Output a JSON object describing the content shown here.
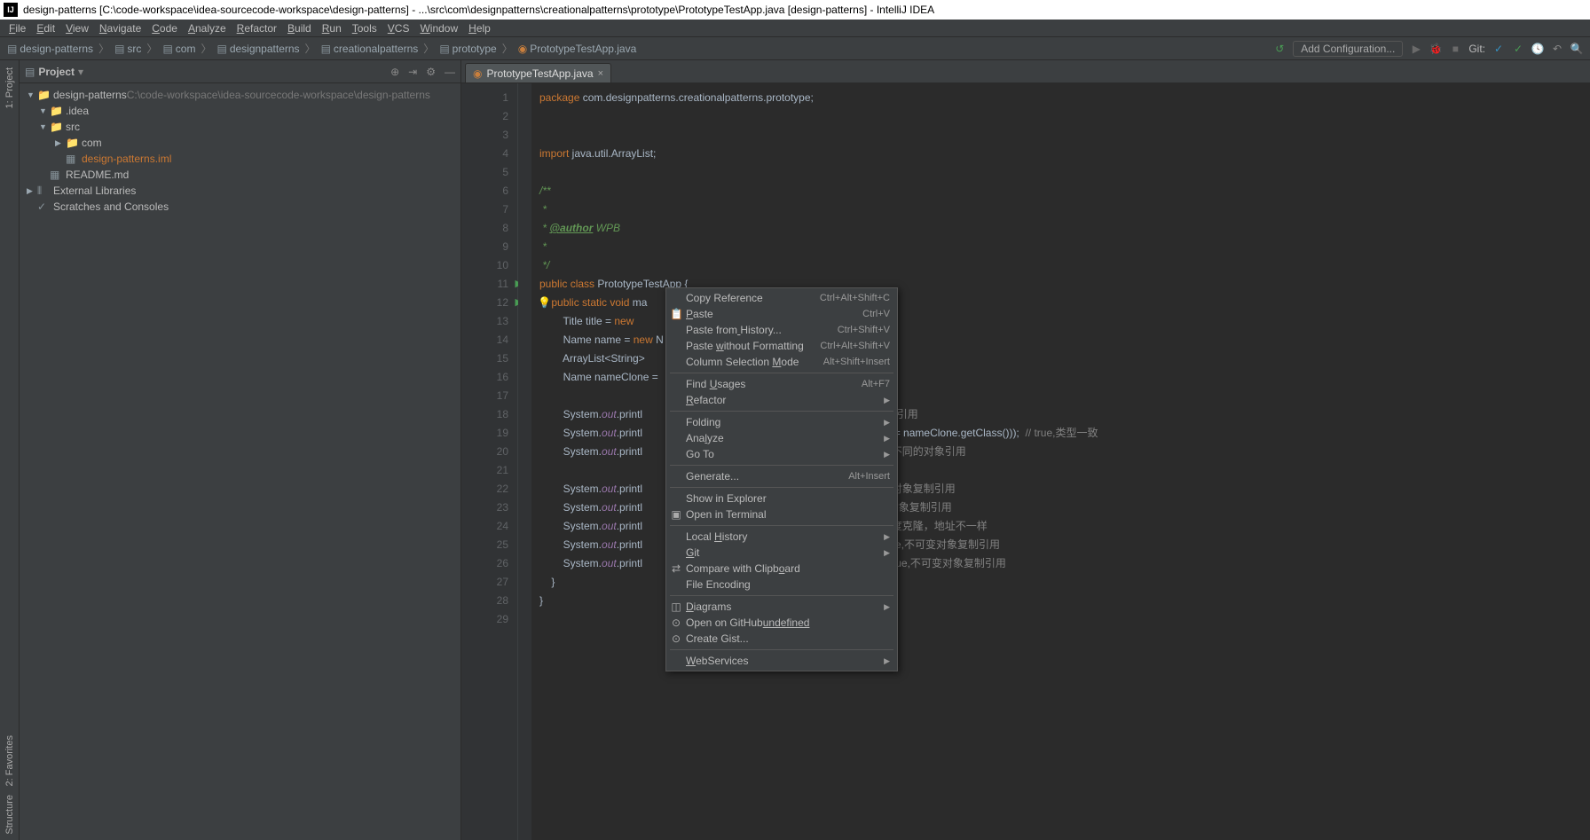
{
  "titlebar": "design-patterns [C:\\code-workspace\\idea-sourcecode-workspace\\design-patterns] - ...\\src\\com\\designpatterns\\creationalpatterns\\prototype\\PrototypeTestApp.java [design-patterns] - IntelliJ IDEA",
  "menu": [
    "File",
    "Edit",
    "View",
    "Navigate",
    "Code",
    "Analyze",
    "Refactor",
    "Build",
    "Run",
    "Tools",
    "VCS",
    "Window",
    "Help"
  ],
  "breadcrumb": [
    "design-patterns",
    "src",
    "com",
    "designpatterns",
    "creationalpatterns",
    "prototype",
    "PrototypeTestApp.java"
  ],
  "add_config": "Add Configuration...",
  "git_label": "Git:",
  "project_panel": {
    "title": "Project"
  },
  "tree": [
    {
      "depth": 0,
      "arrow": "▼",
      "icon": "📁",
      "name": "design-patterns",
      "suffix": "C:\\code-workspace\\idea-sourcecode-workspace\\design-patterns",
      "cls": ""
    },
    {
      "depth": 1,
      "arrow": "▼",
      "icon": "📁",
      "name": ".idea",
      "cls": ""
    },
    {
      "depth": 1,
      "arrow": "▼",
      "icon": "📁",
      "name": "src",
      "cls": ""
    },
    {
      "depth": 2,
      "arrow": "▶",
      "icon": "📁",
      "name": "com",
      "cls": ""
    },
    {
      "depth": 2,
      "arrow": "",
      "icon": "▦",
      "name": "design-patterns.iml",
      "cls": "orange"
    },
    {
      "depth": 1,
      "arrow": "",
      "icon": "▦",
      "name": "README.md",
      "cls": ""
    },
    {
      "depth": 0,
      "arrow": "▶",
      "icon": "⫴",
      "name": "External Libraries",
      "cls": ""
    },
    {
      "depth": 0,
      "arrow": "",
      "icon": "✓",
      "name": "Scratches and Consoles",
      "cls": ""
    }
  ],
  "tab": {
    "name": "PrototypeTestApp.java"
  },
  "code": {
    "lines": [
      {
        "n": 1,
        "html": "<span class='kw'>package</span> com.designpatterns.creationalpatterns.prototype<span class='plain'>;</span>"
      },
      {
        "n": 2,
        "html": ""
      },
      {
        "n": 3,
        "html": ""
      },
      {
        "n": 4,
        "html": "<span class='kw'>import</span> java.util.ArrayList<span class='plain'>;</span>"
      },
      {
        "n": 5,
        "html": ""
      },
      {
        "n": 6,
        "html": "<span class='doc'>/**</span>"
      },
      {
        "n": 7,
        "html": "<span class='doc'> *</span>"
      },
      {
        "n": 8,
        "html": "<span class='doc'> * <span class='doc-tag'>@author</span> WPB</span>"
      },
      {
        "n": 9,
        "html": "<span class='doc'> *</span>"
      },
      {
        "n": 10,
        "html": "<span class='doc'> */</span>"
      },
      {
        "n": 11,
        "html": "<span class='kw'>public class</span> PrototypeTestApp {",
        "run": true
      },
      {
        "n": 12,
        "html": "    <span class='kw'>public static void</span> ma                                        tedException {",
        "run": true,
        "bulb": true
      },
      {
        "n": 13,
        "html": "        Title title = <span class='kw'>new</span>"
      },
      {
        "n": 14,
        "html": "        Name name = <span class='kw'>new</span> N"
      },
      {
        "n": 15,
        "html": "        ArrayList&lt;String&gt;"
      },
      {
        "n": 16,
        "html": "        Name nameClone ="
      },
      {
        "n": 17,
        "html": ""
      },
      {
        "n": 18,
        "html": "        System.<span class='field'>out</span>.printl                                       eClone));    <span class='cmt'>// true,不同的对象引用</span>"
      },
      {
        "n": 19,
        "html": "        System.<span class='field'>out</span>.printl                                       <span class='str'>ass(): \"</span> + (name.getClass() == nameClone.getClass()));  <span class='cmt'>// true,类型一致</span>"
      },
      {
        "n": 20,
        "html": "        System.<span class='field'>out</span>.printl                                       uals(nameClone));    <span class='cmt'>// false,不同的对象引用</span>"
      },
      {
        "n": 21,
        "html": ""
      },
      {
        "n": 22,
        "html": "        System.<span class='field'>out</span>.printl                                       FirstName());   <span class='cmt'>// true,不可变对象复制引用</span>"
      },
      {
        "n": 23,
        "html": "        System.<span class='field'>out</span>.printl                                       astName());    <span class='cmt'>// true,不可变对象复制引用</span>"
      },
      {
        "n": 24,
        "html": "        System.<span class='field'>out</span>.printl                                       e());         <span class='cmt'>// false,可变对象深度克隆，地址不一样</span>"
      },
      {
        "n": 25,
        "html": "        System.<span class='field'>out</span>.printl                                       e.getTitle().getPre());      <span class='cmt'>// true,不可变对象复制引用</span>"
      },
      {
        "n": 26,
        "html": "        System.<span class='field'>out</span>.printl                                       ame.getTitle().getTitle());  <span class='cmt'>// true,不可变对象复制引用</span>"
      },
      {
        "n": 27,
        "html": "    }"
      },
      {
        "n": 28,
        "html": "}"
      },
      {
        "n": 29,
        "html": ""
      }
    ]
  },
  "context_menu": [
    {
      "label": "Copy Reference",
      "sc": "Ctrl+Alt+Shift+C"
    },
    {
      "label": "Paste",
      "sc": "Ctrl+V",
      "icon": "📋",
      "u": 0
    },
    {
      "label": "Paste from History...",
      "sc": "Ctrl+Shift+V",
      "u": 10
    },
    {
      "label": "Paste without Formatting",
      "sc": "Ctrl+Alt+Shift+V",
      "u": 6
    },
    {
      "label": "Column Selection Mode",
      "sc": "Alt+Shift+Insert",
      "u": 17
    },
    {
      "sep": true
    },
    {
      "label": "Find Usages",
      "sc": "Alt+F7",
      "u": 5
    },
    {
      "label": "Refactor",
      "arrow": true,
      "u": 0
    },
    {
      "sep": true
    },
    {
      "label": "Folding",
      "arrow": true
    },
    {
      "label": "Analyze",
      "arrow": true,
      "u": 3
    },
    {
      "label": "Go To",
      "arrow": true
    },
    {
      "sep": true
    },
    {
      "label": "Generate...",
      "sc": "Alt+Insert"
    },
    {
      "sep": true
    },
    {
      "label": "Show in Explorer"
    },
    {
      "label": "Open in Terminal",
      "icon": "▣"
    },
    {
      "sep": true
    },
    {
      "label": "Local History",
      "arrow": true,
      "u": 6
    },
    {
      "label": "Git",
      "arrow": true,
      "u": 0
    },
    {
      "label": "Compare with Clipboard",
      "icon": "⇄",
      "u": 18
    },
    {
      "label": "File Encoding"
    },
    {
      "sep": true
    },
    {
      "label": "Diagrams",
      "arrow": true,
      "icon": "◫",
      "u": 0
    },
    {
      "label": "Open on GitHub",
      "icon": "⊙",
      "u": 17
    },
    {
      "label": "Create Gist...",
      "icon": "⊙"
    },
    {
      "sep": true
    },
    {
      "label": "WebServices",
      "arrow": true,
      "u": 0
    }
  ],
  "left_tabs": [
    "1: Project"
  ],
  "bottom_left_tabs": [
    "2: Favorites",
    "Structure"
  ]
}
